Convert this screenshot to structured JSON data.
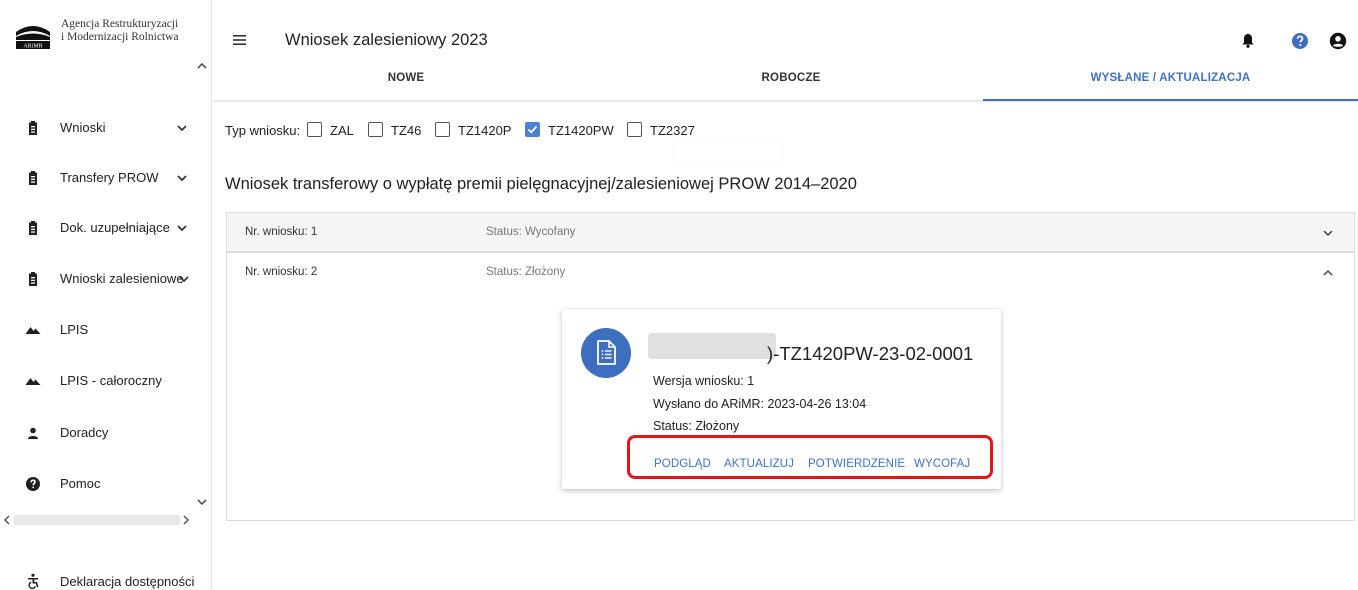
{
  "logo": {
    "line1": "Agencja Restrukturyzacji",
    "line2": "i Modernizacji Rolnictwa",
    "mark_text": "ARiMR"
  },
  "sidebar": {
    "items": [
      {
        "label": "Wnioski",
        "icon": "clipboard-icon",
        "has_chevron": true
      },
      {
        "label": "Transfery PROW",
        "icon": "clipboard-icon",
        "has_chevron": true
      },
      {
        "label": "Dok. uzupełniające",
        "icon": "clipboard-icon",
        "has_chevron": true
      },
      {
        "label": "Wnioski zalesieniowe",
        "icon": "clipboard-icon",
        "has_chevron": true
      },
      {
        "label": "LPIS",
        "icon": "mountain-icon",
        "has_chevron": false
      },
      {
        "label": "LPIS - całoroczny",
        "icon": "mountain-icon",
        "has_chevron": false
      },
      {
        "label": "Doradcy",
        "icon": "person-icon",
        "has_chevron": false
      },
      {
        "label": "Pomoc",
        "icon": "help-icon",
        "has_chevron": false
      }
    ],
    "footer": {
      "label": "Deklaracja dostępności",
      "icon": "accessibility-icon"
    }
  },
  "header": {
    "title": "Wniosek zalesieniowy 2023",
    "icons": [
      "bell-icon",
      "help-icon",
      "account-icon"
    ]
  },
  "tabs": [
    {
      "label": "NOWE",
      "active": false
    },
    {
      "label": "ROBOCZE",
      "active": false
    },
    {
      "label": "WYSŁANE / AKTUALIZACJA",
      "active": true
    }
  ],
  "filter": {
    "label": "Typ wniosku:",
    "options": [
      {
        "label": "ZAL",
        "checked": false
      },
      {
        "label": "TZ46",
        "checked": false
      },
      {
        "label": "TZ1420P",
        "checked": false
      },
      {
        "label": "TZ1420PW",
        "checked": true
      },
      {
        "label": "TZ2327",
        "checked": false
      }
    ]
  },
  "section_title": "Wniosek transferowy o wypłatę premii pielęgnacyjnej/zalesieniowej PROW 2014–2020",
  "panels": [
    {
      "nr": "Nr. wniosku: 1",
      "status": "Status: Wycofany",
      "expanded": false
    },
    {
      "nr": "Nr. wniosku: 2",
      "status": "Status: Złożony",
      "expanded": true
    }
  ],
  "card": {
    "title_suffix": ")-TZ1420PW-23-02-0001",
    "version": "Wersja wniosku: 1",
    "sent": "Wysłano do ARiMR: 2023-04-26 13:04",
    "status": "Status: Złożony",
    "actions": [
      "PODGLĄD",
      "AKTUALIZUJ",
      "POTWIERDZENIE",
      "WYCOFAJ"
    ]
  },
  "colors": {
    "accent": "#3d72c4",
    "highlight": "#e0161b",
    "avatar": "#3d6ec0"
  }
}
